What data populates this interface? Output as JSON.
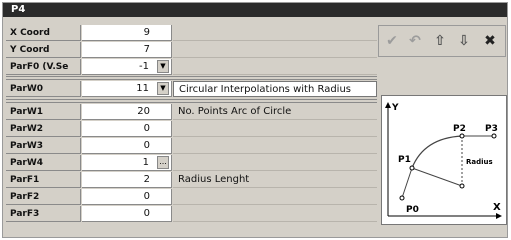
{
  "window": {
    "title": "P4"
  },
  "rows": [
    {
      "label": "X Coord",
      "value": "9",
      "description": ""
    },
    {
      "label": "Y Coord",
      "value": "7",
      "description": ""
    },
    {
      "label": "ParF0 (V.Se",
      "value": "-1",
      "description": "",
      "control": "dropdown"
    },
    {
      "label": "ParW0",
      "value": "11",
      "description": "Circular Interpolations with Radius",
      "control": "dropdown"
    },
    {
      "label": "ParW1",
      "value": "20",
      "description": "No. Points Arc of Circle"
    },
    {
      "label": "ParW2",
      "value": "0",
      "description": ""
    },
    {
      "label": "ParW3",
      "value": "0",
      "description": ""
    },
    {
      "label": "ParW4",
      "value": "1",
      "description": "",
      "control": "ellipsis"
    },
    {
      "label": "ParF1",
      "value": "2",
      "description": "Radius Lenght"
    },
    {
      "label": "ParF2",
      "value": "0",
      "description": ""
    },
    {
      "label": "ParF3",
      "value": "0",
      "description": ""
    }
  ],
  "controls": {
    "dropdown_glyph": "▼",
    "ellipsis_glyph": "..."
  },
  "toolbar": {
    "icons": [
      "checkmark-icon",
      "undo-icon",
      "arrow-up-icon",
      "arrow-down-icon",
      "close-icon"
    ],
    "glyphs": {
      "check": "✔",
      "undo": "↶",
      "up": "⇧",
      "down": "⇩",
      "close": "✖"
    }
  },
  "diagram": {
    "labels": {
      "y": "Y",
      "x": "X",
      "p0": "P0",
      "p1": "P1",
      "p2": "P2",
      "p3": "P3",
      "radius": "Radius"
    }
  },
  "colors": {
    "panel": "#d4d0c8",
    "titlebar": "#2b2b2b",
    "field": "#ffffff"
  }
}
